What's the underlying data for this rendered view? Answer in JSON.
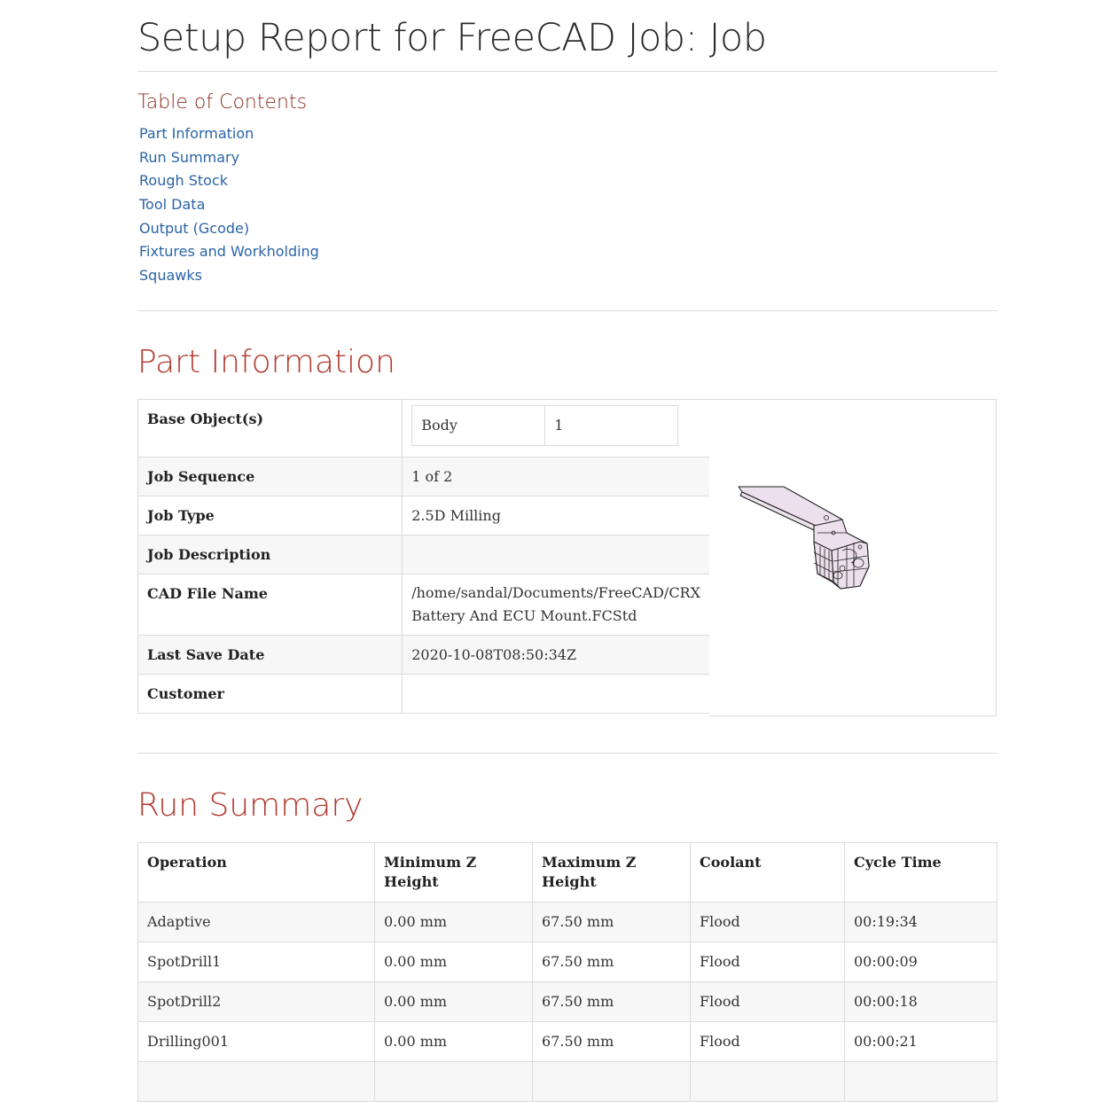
{
  "report": {
    "title": "Setup Report for FreeCAD Job: Job",
    "toc": {
      "heading": "Table of Contents",
      "items": [
        "Part Information",
        "Run Summary",
        "Rough Stock",
        "Tool Data",
        "Output (Gcode)",
        "Fixtures and Workholding",
        "Squawks"
      ]
    }
  },
  "part_information": {
    "heading": "Part Information",
    "base_objects": {
      "label": "Base Object(s)",
      "name": "Body",
      "count": "1"
    },
    "job_sequence": {
      "label": "Job Sequence",
      "value": "1 of 2"
    },
    "job_type": {
      "label": "Job Type",
      "value": "2.5D Milling"
    },
    "job_description": {
      "label": "Job Description",
      "value": ""
    },
    "cad_file": {
      "label": "CAD File Name",
      "value_line1": "/home/sandal/Documents/FreeCAD/CRX",
      "value_line2": "Battery And ECU Mount.FCStd"
    },
    "last_save": {
      "label": "Last Save Date",
      "value": "2020-10-08T08:50:34Z"
    },
    "customer": {
      "label": "Customer",
      "value": ""
    }
  },
  "run_summary": {
    "heading": "Run Summary",
    "columns": [
      "Operation",
      "Minimum Z Height",
      "Maximum Z Height",
      "Coolant",
      "Cycle Time"
    ],
    "rows": [
      [
        "Adaptive",
        "0.00 mm",
        "67.50 mm",
        "Flood",
        "00:19:34"
      ],
      [
        "SpotDrill1",
        "0.00 mm",
        "67.50 mm",
        "Flood",
        "00:00:09"
      ],
      [
        "SpotDrill2",
        "0.00 mm",
        "67.50 mm",
        "Flood",
        "00:00:18"
      ],
      [
        "Drilling001",
        "0.00 mm",
        "67.50 mm",
        "Flood",
        "00:00:21"
      ]
    ]
  },
  "colors": {
    "link": "#2a64a8",
    "section_heading": "#b03a2e",
    "toc_heading": "#8b2e22",
    "part_fill": "#e8dde8"
  }
}
